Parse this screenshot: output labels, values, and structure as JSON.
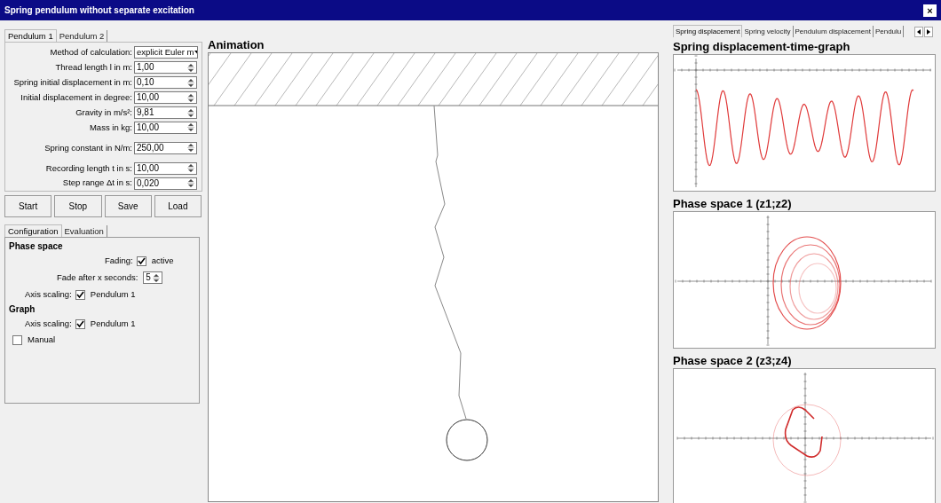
{
  "window": {
    "title": "Spring pendulum without separate excitation",
    "close": "×"
  },
  "pendulum_tabs": [
    {
      "label": "Pendulum 1",
      "selected": true
    },
    {
      "label": "Pendulum 2",
      "selected": false
    }
  ],
  "parameters": [
    {
      "kind": "dropdown",
      "label": "Method of calculation:",
      "value": "explicit Euler m",
      "gap_before": false
    },
    {
      "kind": "spinner",
      "label": "Thread length l in m:",
      "value": "1,00",
      "gap_before": false
    },
    {
      "kind": "spinner",
      "label": "Spring initial displacement in m:",
      "value": "0,10",
      "gap_before": false
    },
    {
      "kind": "spinner",
      "label": "Initial displacement in degree:",
      "value": "10,00",
      "gap_before": false
    },
    {
      "kind": "spinner",
      "label": "Gravity in m/s²:",
      "value": "9,81",
      "gap_before": false
    },
    {
      "kind": "spinner",
      "label": "Mass in kg:",
      "value": "10,00",
      "gap_before": false
    },
    {
      "kind": "spinner",
      "label": "Spring constant in N/m:",
      "value": "250,00",
      "gap_before": true
    },
    {
      "kind": "spinner",
      "label": "Recording length t in s:",
      "value": "10,00",
      "gap_before": true
    },
    {
      "kind": "spinner",
      "label": "Step range Δt in s:",
      "value": "0,020",
      "gap_before": false
    }
  ],
  "buttons": [
    "Start",
    "Stop",
    "Save",
    "Load"
  ],
  "settings_tabs": [
    {
      "label": "Configuration",
      "selected": true
    },
    {
      "label": "Evaluation",
      "selected": false
    }
  ],
  "settings": [
    {
      "kind": "heading",
      "label": "Phase space"
    },
    {
      "kind": "check_right",
      "label": "Fading:",
      "text": "active",
      "checked": true
    },
    {
      "kind": "spinner_right",
      "label": "Fade after x seconds:",
      "value": "5"
    },
    {
      "kind": "check",
      "label": "Axis scaling:",
      "text": "Pendulum 1",
      "checked": true
    },
    {
      "kind": "heading",
      "label": "Graph"
    },
    {
      "kind": "check",
      "label": "Axis scaling:",
      "text": "Pendulum 1",
      "checked": true
    },
    {
      "kind": "check",
      "text": "Manual",
      "checked": false
    }
  ],
  "animation": {
    "title": "Animation"
  },
  "graph_tabs": [
    {
      "label": "Spring displacement",
      "selected": true
    },
    {
      "label": "Spring velocity",
      "selected": false
    },
    {
      "label": "Pendulum displacement",
      "selected": false
    },
    {
      "label": "Pendulu",
      "selected": false
    }
  ],
  "graphs": [
    {
      "kind": "time",
      "title": "Spring displacement-time-graph"
    },
    {
      "kind": "phase1",
      "title": "Phase space 1 (z1;z2)"
    },
    {
      "kind": "phase2",
      "title": "Phase space 2 (z3;z4)"
    }
  ]
}
